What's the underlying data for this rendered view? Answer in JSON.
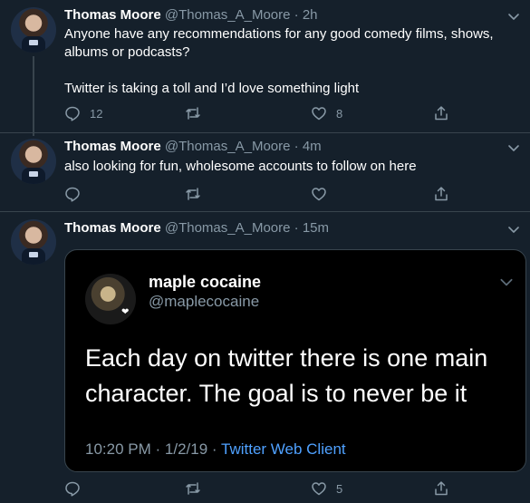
{
  "tweets": [
    {
      "name": "Thomas Moore",
      "handle": "@Thomas_A_Moore",
      "time": "2h",
      "text_lines": [
        "Anyone have any recommendations for any good comedy films, shows,",
        "albums or podcasts?",
        "",
        "Twitter is taking a toll and I’d love something light"
      ],
      "reply_count": "12",
      "retweet_count": "",
      "like_count": "8"
    },
    {
      "name": "Thomas Moore",
      "handle": "@Thomas_A_Moore",
      "time": "4m",
      "text_lines": [
        "also looking for fun, wholesome accounts to follow on here"
      ],
      "reply_count": "",
      "retweet_count": "",
      "like_count": ""
    },
    {
      "name": "Thomas Moore",
      "handle": "@Thomas_A_Moore",
      "time": "15m",
      "reply_count": "",
      "retweet_count": "",
      "like_count": "5",
      "embed": {
        "name": "maple cocaine",
        "handle": "@maplecocaine",
        "text_lines": [
          "Each day on twitter there is one main",
          "character. The goal is to never be it"
        ],
        "time": "10:20 PM",
        "date": "1/2/19",
        "separator": "·",
        "client": "Twitter Web Client"
      }
    }
  ],
  "meta_dot": "·",
  "icons": {
    "reply": "reply-icon",
    "retweet": "retweet-icon",
    "like": "heart-icon",
    "share": "share-icon",
    "menu": "chevron-down-icon"
  },
  "colors": {
    "background": "#15202b",
    "secondary_text": "#8899a6",
    "link": "#4fa1ff",
    "border": "#38444d"
  }
}
